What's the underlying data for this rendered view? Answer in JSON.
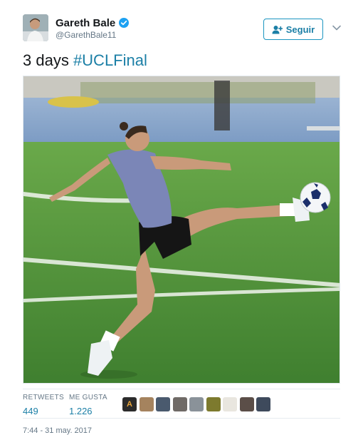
{
  "author": {
    "display_name": "Gareth Bale",
    "handle": "@GarethBale11",
    "verified": true
  },
  "follow_button": {
    "label": "Seguir",
    "icon": "add-user-icon"
  },
  "tweet": {
    "text_prefix": "3 days ",
    "hashtag": "#UCLFinal"
  },
  "stats": {
    "retweets_label": "RETWEETS",
    "retweets_count": "449",
    "likes_label": "ME GUSTA",
    "likes_count": "1.226"
  },
  "likers": [
    {
      "initial": "A",
      "color": "#2b2b2b"
    },
    {
      "initial": "",
      "color": "#a5835e"
    },
    {
      "initial": "",
      "color": "#4a5a6e"
    },
    {
      "initial": "",
      "color": "#6f6a66"
    },
    {
      "initial": "",
      "color": "#8a9299"
    },
    {
      "initial": "",
      "color": "#7d7a2e"
    },
    {
      "initial": "",
      "color": "#e9e6df"
    },
    {
      "initial": "",
      "color": "#5b4e48"
    },
    {
      "initial": "",
      "color": "#3e4a5c"
    }
  ],
  "timestamp": "7:44 - 31 may. 2017",
  "colors": {
    "link": "#1b7fa6",
    "verified_badge": "#1da1f2",
    "secondary_text": "#657786"
  }
}
